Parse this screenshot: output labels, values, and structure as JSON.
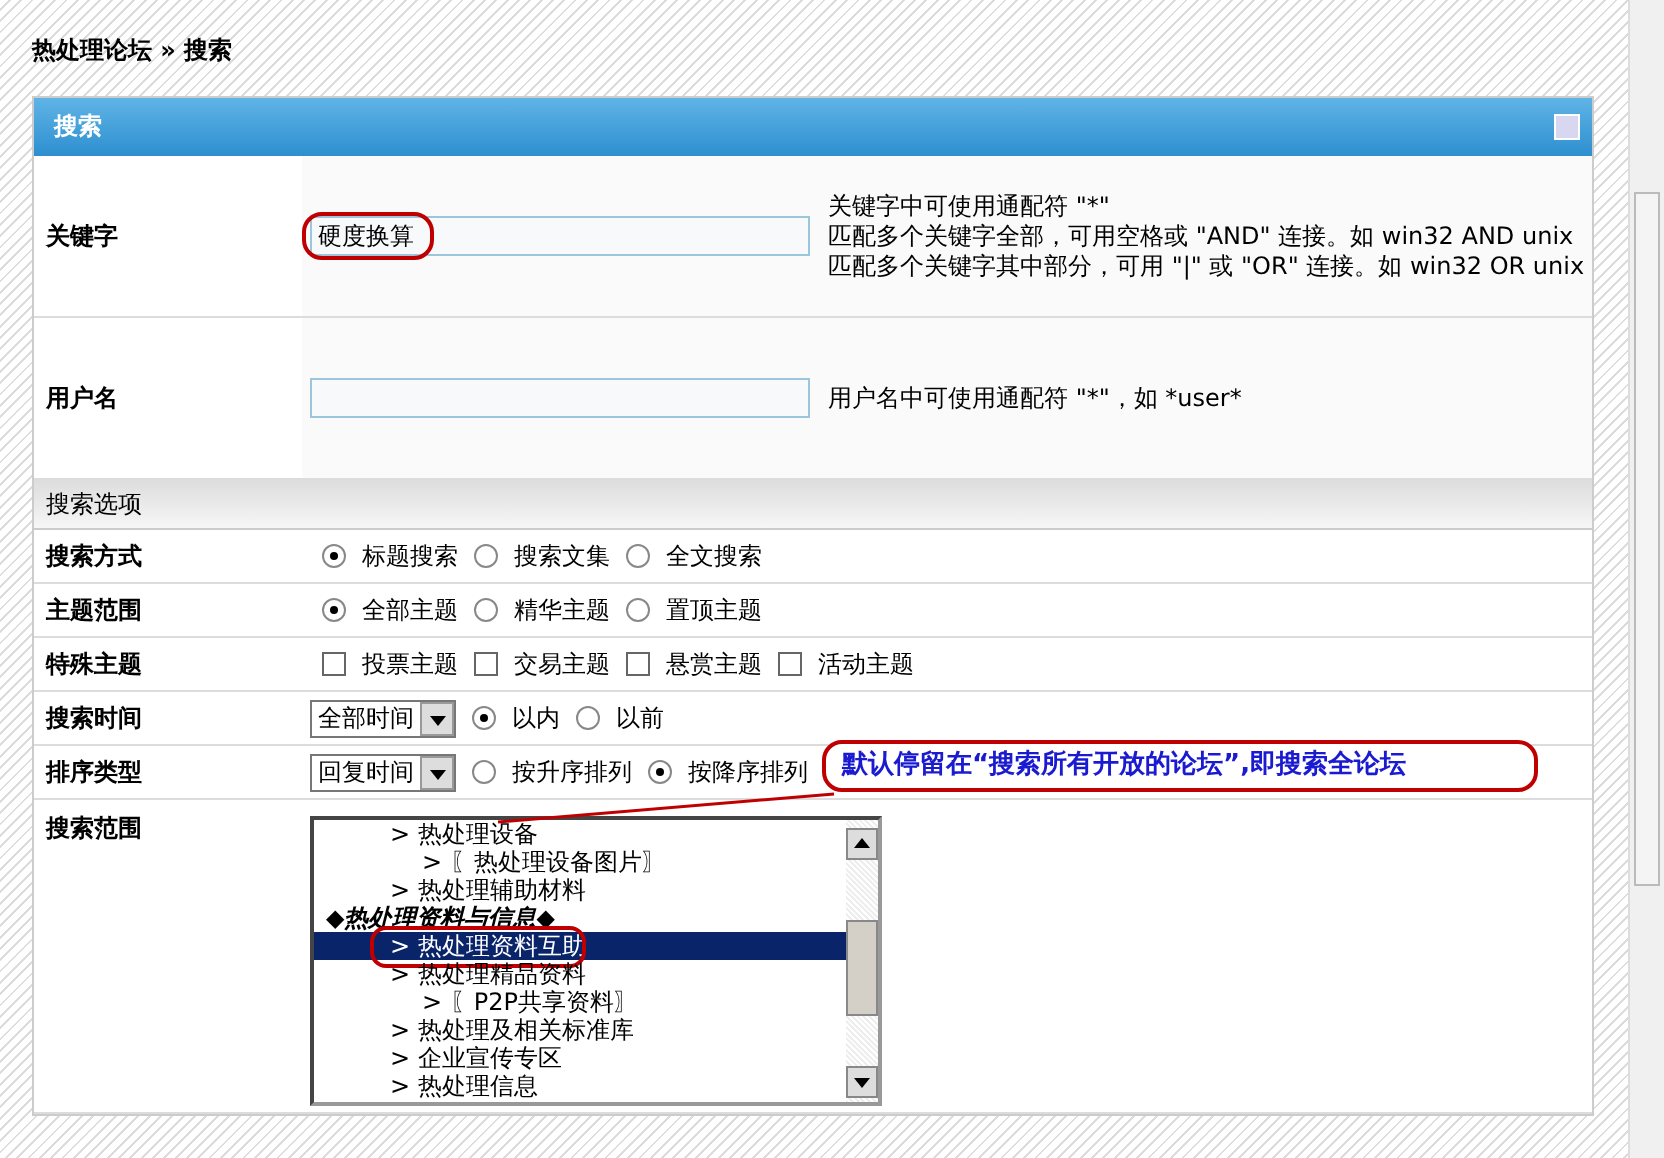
{
  "breadcrumb": {
    "text": "热处理论坛 » 搜索"
  },
  "panel": {
    "title": "搜索"
  },
  "keyword": {
    "label": "关键字",
    "value": "硬度换算",
    "hints": [
      "关键字中可使用通配符 \"*\"",
      "匹配多个关键字全部，可用空格或 \"AND\" 连接。如 win32 AND unix",
      "匹配多个关键字其中部分，可用 \"|\" 或 \"OR\" 连接。如 win32 OR unix"
    ]
  },
  "username": {
    "label": "用户名",
    "hint": "用户名中可使用通配符 \"*\"，如 *user*"
  },
  "options_header": "搜索选项",
  "options": [
    {
      "kind": "radio",
      "label": "搜索方式",
      "choices": [
        {
          "label": "标题搜索",
          "selected": true
        },
        {
          "label": "搜索文集",
          "selected": false
        },
        {
          "label": "全文搜索",
          "selected": false
        }
      ]
    },
    {
      "kind": "radio",
      "label": "主题范围",
      "choices": [
        {
          "label": "全部主题",
          "selected": true
        },
        {
          "label": "精华主题",
          "selected": false
        },
        {
          "label": "置顶主题",
          "selected": false
        }
      ]
    },
    {
      "kind": "checkbox",
      "label": "特殊主题",
      "choices": [
        {
          "label": "投票主题",
          "checked": false
        },
        {
          "label": "交易主题",
          "checked": false
        },
        {
          "label": "悬赏主题",
          "checked": false
        },
        {
          "label": "活动主题",
          "checked": false
        }
      ]
    },
    {
      "kind": "select_radio",
      "label": "搜索时间",
      "select": "全部时间",
      "choices": [
        {
          "label": "以内",
          "selected": true
        },
        {
          "label": "以前",
          "selected": false
        }
      ]
    },
    {
      "kind": "select_radio",
      "label": "排序类型",
      "select": "回复时间",
      "choices": [
        {
          "label": "按升序排列",
          "selected": false
        },
        {
          "label": "按降序排列",
          "selected": true
        }
      ]
    }
  ],
  "forum_scope": {
    "label": "搜索范围",
    "items": [
      {
        "kind": "forum",
        "text": "> 热处理设备",
        "selected": false,
        "children": [
          {
            "kind": "forum",
            "text": "> 〖热处理设备图片〗",
            "selected": false
          }
        ]
      },
      {
        "kind": "forum",
        "text": "> 热处理辅助材料",
        "selected": false
      },
      {
        "kind": "group",
        "text": "◆热处理资料与信息◆",
        "selected": false,
        "children": [
          {
            "kind": "forum",
            "text": "> 热处理资料互助",
            "selected": true
          },
          {
            "kind": "forum",
            "text": "> 热处理精品资料",
            "selected": false,
            "children": [
              {
                "kind": "forum",
                "text": "> 〖P2P共享资料〗",
                "selected": false
              }
            ]
          },
          {
            "kind": "forum",
            "text": "> 热处理及相关标准库",
            "selected": false
          },
          {
            "kind": "forum",
            "text": "> 企业宣传专区",
            "selected": false
          },
          {
            "kind": "forum",
            "text": "> 热处理信息",
            "selected": false
          }
        ]
      }
    ]
  },
  "annotation": {
    "text": "默认停留在“搜索所有开放的论坛”,即搜索全论坛"
  }
}
